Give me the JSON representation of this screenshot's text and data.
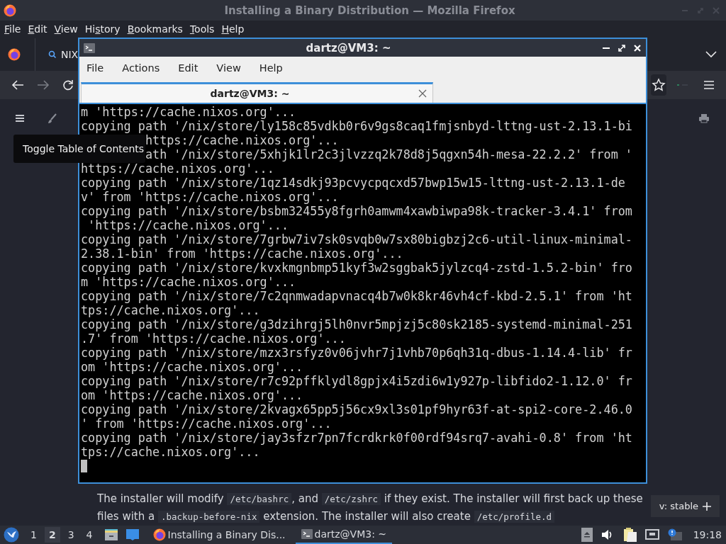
{
  "firefox": {
    "title": "Installing a Binary Distribution — Mozilla Firefox",
    "menu": [
      {
        "key": "F",
        "post": "ile"
      },
      {
        "key": "E",
        "post": "dit"
      },
      {
        "key": "V",
        "post": "iew"
      },
      {
        "pre": "Hi",
        "key": "s",
        "post": "tory"
      },
      {
        "key": "B",
        "post": "ookmarks"
      },
      {
        "key": "T",
        "post": "ools"
      },
      {
        "key": "H",
        "post": "elp"
      }
    ],
    "tab": {
      "title": "NIX"
    },
    "page": {
      "tooltip": "Toggle Table of Contents",
      "paragraph": [
        {
          "kind": "text",
          "text": "The installer will modify "
        },
        {
          "kind": "code",
          "text": "/etc/bashrc"
        },
        {
          "kind": "text",
          "text": ", and "
        },
        {
          "kind": "code",
          "text": "/etc/zshrc"
        },
        {
          "kind": "text",
          "text": " if they exist. The installer will first back up these files with a "
        },
        {
          "kind": "code",
          "text": ".backup-before-nix"
        },
        {
          "kind": "text",
          "text": " extension. The installer will also create "
        },
        {
          "kind": "code",
          "text": "/etc/profile.d"
        }
      ],
      "version_badge": "v: stable"
    }
  },
  "terminal": {
    "title": "dartz@VM3: ~",
    "menu": [
      "File",
      "Actions",
      "Edit",
      "View",
      "Help"
    ],
    "tab": {
      "title": "dartz@VM3: ~",
      "selected": true
    },
    "lines": [
      {
        "kind": "full",
        "text": "m 'https://cache.nixos.org'..."
      },
      {
        "kind": "full",
        "text": "copying path '/nix/store/ly158c85vdkb0r6v9gs8caq1fmjsnbyd-lttng-ust-2.13.1-bi"
      },
      {
        "kind": "covered",
        "text": "https://cache.nixos.org'..."
      },
      {
        "kind": "covered",
        "text": "ath '/nix/store/5xhjk1lr2c3jlvzzq2k78d8j5qgxn54h-mesa-22.2.2' from '"
      },
      {
        "kind": "full",
        "text": "https://cache.nixos.org'..."
      },
      {
        "kind": "full",
        "text": "copying path '/nix/store/1qz14sdkj93pcvycpqcxd57bwp15w15-lttng-ust-2.13.1-de"
      },
      {
        "kind": "full",
        "text": "v' from 'https://cache.nixos.org'..."
      },
      {
        "kind": "full",
        "text": "copying path '/nix/store/bsbm32455y8fgrh0amwm4xawbiwpa98k-tracker-3.4.1' from"
      },
      {
        "kind": "full",
        "text": " 'https://cache.nixos.org'..."
      },
      {
        "kind": "full",
        "text": "copying path '/nix/store/7grbw7iv7sk0svqb0w7sx80bigbzj2c6-util-linux-minimal-"
      },
      {
        "kind": "full",
        "text": "2.38.1-bin' from 'https://cache.nixos.org'..."
      },
      {
        "kind": "full",
        "text": "copying path '/nix/store/kvxkmgnbmp51kyf3w2sggbak5jylzcq4-zstd-1.5.2-bin' fro"
      },
      {
        "kind": "full",
        "text": "m 'https://cache.nixos.org'..."
      },
      {
        "kind": "full",
        "text": "copying path '/nix/store/7c2qnmwadapvnacq4b7w0k8kr46vh4cf-kbd-2.5.1' from 'ht"
      },
      {
        "kind": "full",
        "text": "tps://cache.nixos.org'..."
      },
      {
        "kind": "full",
        "text": "copying path '/nix/store/g3dzihrgj5lh0nvr5mpjzj5c80sk2185-systemd-minimal-251"
      },
      {
        "kind": "full",
        "text": ".7' from 'https://cache.nixos.org'..."
      },
      {
        "kind": "full",
        "text": "copying path '/nix/store/mzx3rsfyz0v06jvhr7j1vhb70p6qh31q-dbus-1.14.4-lib' fr"
      },
      {
        "kind": "full",
        "text": "om 'https://cache.nixos.org'..."
      },
      {
        "kind": "full",
        "text": "copying path '/nix/store/r7c92pffklydl8gpjx4i5zdi6w1y927p-libfido2-1.12.0' fr"
      },
      {
        "kind": "full",
        "text": "om 'https://cache.nixos.org'..."
      },
      {
        "kind": "full",
        "text": "copying path '/nix/store/2kvagx65pp5j56cx9xl3s01pf9hyr63f-at-spi2-core-2.46.0"
      },
      {
        "kind": "full",
        "text": "' from 'https://cache.nixos.org'..."
      },
      {
        "kind": "full",
        "text": "copying path '/nix/store/jay3sfzr7pn7fcrdkrk0f00rdf94srq7-avahi-0.8' from 'ht"
      },
      {
        "kind": "full",
        "text": "tps://cache.nixos.org'..."
      }
    ]
  },
  "taskbar": {
    "workspaces": [
      {
        "label": "1",
        "selected": false
      },
      {
        "label": "2",
        "selected": true
      },
      {
        "label": "3",
        "selected": false
      },
      {
        "label": "4",
        "selected": false
      }
    ],
    "tasks": [
      {
        "kind": "browser",
        "label": "Installing a Binary Dis...",
        "selected": false
      },
      {
        "kind": "terminal",
        "label": "dartz@VM3: ~",
        "selected": true
      }
    ],
    "clock": "19:18"
  }
}
